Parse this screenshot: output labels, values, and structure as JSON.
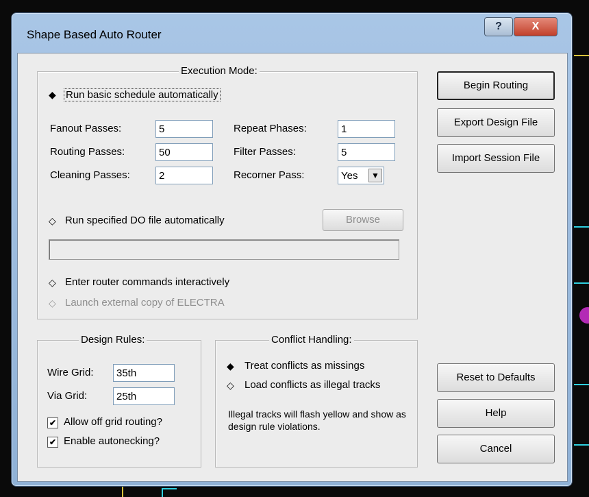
{
  "window": {
    "title": "Shape Based Auto Router",
    "help_glyph": "?",
    "close_glyph": "X"
  },
  "execution_mode": {
    "legend": "Execution Mode:",
    "option_basic": "Run basic schedule automatically",
    "fanout_label": "Fanout Passes:",
    "fanout_value": "5",
    "routing_label": "Routing Passes:",
    "routing_value": "50",
    "cleaning_label": "Cleaning Passes:",
    "cleaning_value": "2",
    "repeat_label": "Repeat Phases:",
    "repeat_value": "1",
    "filter_label": "Filter Passes:",
    "filter_value": "5",
    "recorner_label": "Recorner Pass:",
    "recorner_value": "Yes",
    "option_do": "Run specified DO file automatically",
    "browse_label": "Browse",
    "do_file_path": "",
    "option_interactive": "Enter router commands interactively",
    "option_electra": "Launch external copy of ELECTRA"
  },
  "design_rules": {
    "legend": "Design Rules:",
    "wire_label": "Wire Grid:",
    "wire_value": "35th",
    "via_label": "Via Grid:",
    "via_value": "25th",
    "allow_off_grid": "Allow off grid routing?",
    "enable_autonecking": "Enable autonecking?"
  },
  "conflict_handling": {
    "legend": "Conflict Handling:",
    "option_missing": "Treat conflicts as missings",
    "option_illegal": "Load conflicts as illegal tracks",
    "note": "Illegal tracks will flash yellow and show as design rule violations."
  },
  "buttons": {
    "begin": "Begin Routing",
    "export": "Export Design File",
    "import": "Import Session File",
    "reset": "Reset to Defaults",
    "help": "Help",
    "cancel": "Cancel"
  },
  "glyphs": {
    "radio_on": "◆",
    "radio_off": "◇",
    "check": "✔",
    "dropdown": "▼"
  }
}
